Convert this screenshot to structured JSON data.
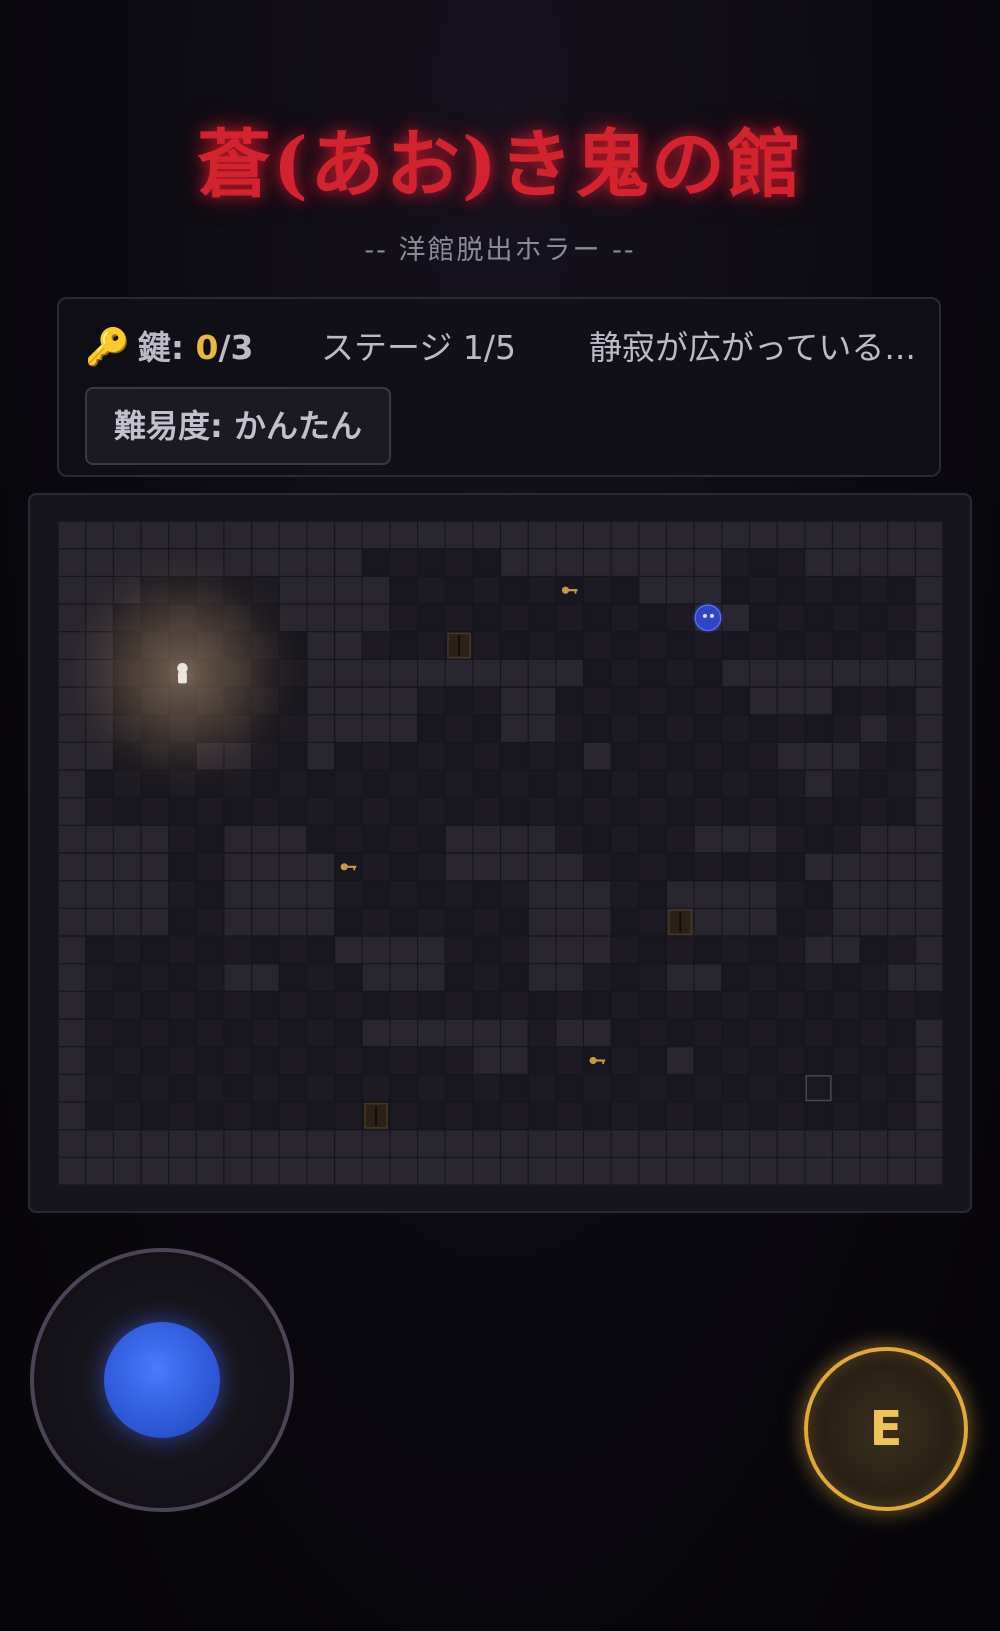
{
  "header": {
    "title": "蒼(あお)き鬼の館",
    "subtitle": "-- 洋館脱出ホラー --"
  },
  "status": {
    "keys_label": "鍵:",
    "keys_current": "0",
    "keys_total": "/3",
    "stage": "ステージ 1/5",
    "message": "静寂が広がっている...",
    "difficulty": "難易度: かんたん"
  },
  "controls": {
    "action_button_label": "E"
  },
  "colors": {
    "title": "#d2232e",
    "key": "#e6b43c",
    "joystick": "#3a66f0",
    "action_ring": "#e0a93a",
    "monster": "#2e46c9"
  },
  "icons": {
    "key_stat": "key-icon",
    "player": "player-icon",
    "monster": "blue-oni-icon",
    "item_key": "key-icon",
    "closet": "closet-icon",
    "exit": "exit-icon"
  },
  "maze": {
    "cols": 32,
    "rows": 24,
    "grid": [
      "################################",
      "###########.....########...#####",
      "###.....####.........###.......#",
      "##......####...........##......#",
      "##.......##....................#",
      "##.......##########.....########",
      "##.......####...##.......###...#",
      "##.......####...##...........#.#",
      "##...##..#.........#......###..#",
      "#..........................#...#",
      "#..............................#",
      "####..###.....####.....###...###",
      "####..####....#####........#####",
      "####..####.......###..####..####",
      "####..####.......###..####..####",
      "#.........####...###.......##..#",
      "#.....##...###...##...##......##",
      "#...............................#",
      "#..........######.##...........#",
      "#..............##.....#........#",
      "#..............................#",
      "#..............................#",
      "################################",
      "################################"
    ],
    "player": {
      "col": 4,
      "row": 5
    },
    "monster": {
      "col": 23,
      "row": 3
    },
    "keys": [
      {
        "col": 18,
        "row": 2
      },
      {
        "col": 10,
        "row": 12
      },
      {
        "col": 19,
        "row": 19
      }
    ],
    "closets": [
      {
        "col": 14,
        "row": 4
      },
      {
        "col": 22,
        "row": 14
      },
      {
        "col": 11,
        "row": 21
      }
    ],
    "exit": {
      "col": 27,
      "row": 20
    }
  }
}
